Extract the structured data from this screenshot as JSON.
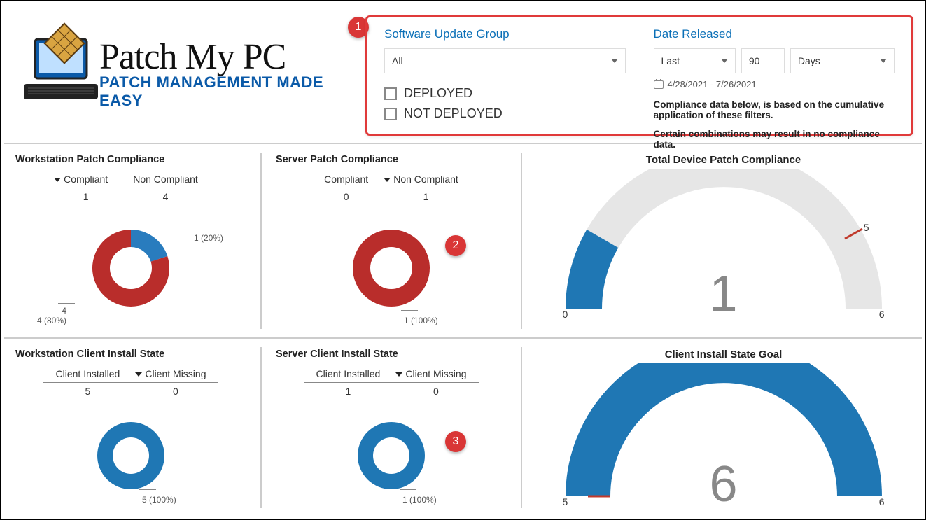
{
  "brand": {
    "line1": "Patch My PC",
    "line2": "PATCH MANAGEMENT MADE EASY"
  },
  "callouts": {
    "c1": "1",
    "c2": "2",
    "c3": "3"
  },
  "filters": {
    "group_label": "Software Update Group",
    "group_value": "All",
    "deployed_label": "DEPLOYED",
    "not_deployed_label": "NOT DEPLOYED",
    "date_label": "Date Released",
    "rel_mode": "Last",
    "rel_value": "90",
    "rel_unit": "Days",
    "date_range": "4/28/2021 - 7/26/2021",
    "note1": "Compliance data below, is based on the cumulative application of these filters.",
    "note2": "Certain combinations may result in no compliance data."
  },
  "tiles": {
    "ws_patch": {
      "title": "Workstation Patch Compliance",
      "col1": "Compliant",
      "col2": "Non Compliant",
      "v1": "1",
      "v2": "4",
      "lab_top": "1 (20%)",
      "lab_bot": "4 (80%)"
    },
    "srv_patch": {
      "title": "Server Patch Compliance",
      "col1": "Compliant",
      "col2": "Non Compliant",
      "v1": "0",
      "v2": "1",
      "lab_bot": "1 (100%)"
    },
    "total_patch": {
      "title": "Total Device Patch Compliance",
      "center": "1",
      "left": "0",
      "right": "6",
      "target": "5"
    },
    "ws_client": {
      "title": "Workstation Client Install State",
      "col1": "Client Installed",
      "col2": "Client Missing",
      "v1": "5",
      "v2": "0",
      "lab_bot": "5 (100%)"
    },
    "srv_client": {
      "title": "Server Client Install State",
      "col1": "Client Installed",
      "col2": "Client Missing",
      "v1": "1",
      "v2": "0",
      "lab_bot": "1 (100%)"
    },
    "client_goal": {
      "title": "Client Install State Goal",
      "center": "6",
      "left": "5",
      "right": "6"
    }
  },
  "chart_data": [
    {
      "id": "ws_patch",
      "type": "pie",
      "title": "Workstation Patch Compliance",
      "series": [
        {
          "name": "Compliant",
          "value": 1,
          "pct": 20,
          "color": "#1f77b4"
        },
        {
          "name": "Non Compliant",
          "value": 4,
          "pct": 80,
          "color": "#c0392b"
        }
      ]
    },
    {
      "id": "srv_patch",
      "type": "pie",
      "title": "Server Patch Compliance",
      "series": [
        {
          "name": "Compliant",
          "value": 0,
          "pct": 0,
          "color": "#1f77b4"
        },
        {
          "name": "Non Compliant",
          "value": 1,
          "pct": 100,
          "color": "#c0392b"
        }
      ]
    },
    {
      "id": "total_patch",
      "type": "gauge",
      "title": "Total Device Patch Compliance",
      "value": 1,
      "min": 0,
      "max": 6,
      "target": 5,
      "fill_color": "#1f77b4"
    },
    {
      "id": "ws_client",
      "type": "pie",
      "title": "Workstation Client Install State",
      "series": [
        {
          "name": "Client Installed",
          "value": 5,
          "pct": 100,
          "color": "#1f77b4"
        },
        {
          "name": "Client Missing",
          "value": 0,
          "pct": 0,
          "color": "#c0392b"
        }
      ]
    },
    {
      "id": "srv_client",
      "type": "pie",
      "title": "Server Client Install State",
      "series": [
        {
          "name": "Client Installed",
          "value": 1,
          "pct": 100,
          "color": "#1f77b4"
        },
        {
          "name": "Client Missing",
          "value": 0,
          "pct": 0,
          "color": "#c0392b"
        }
      ]
    },
    {
      "id": "client_goal",
      "type": "gauge",
      "title": "Client Install State Goal",
      "value": 6,
      "min": 0,
      "max": 6,
      "target": 5,
      "fill_color": "#1f77b4"
    }
  ]
}
